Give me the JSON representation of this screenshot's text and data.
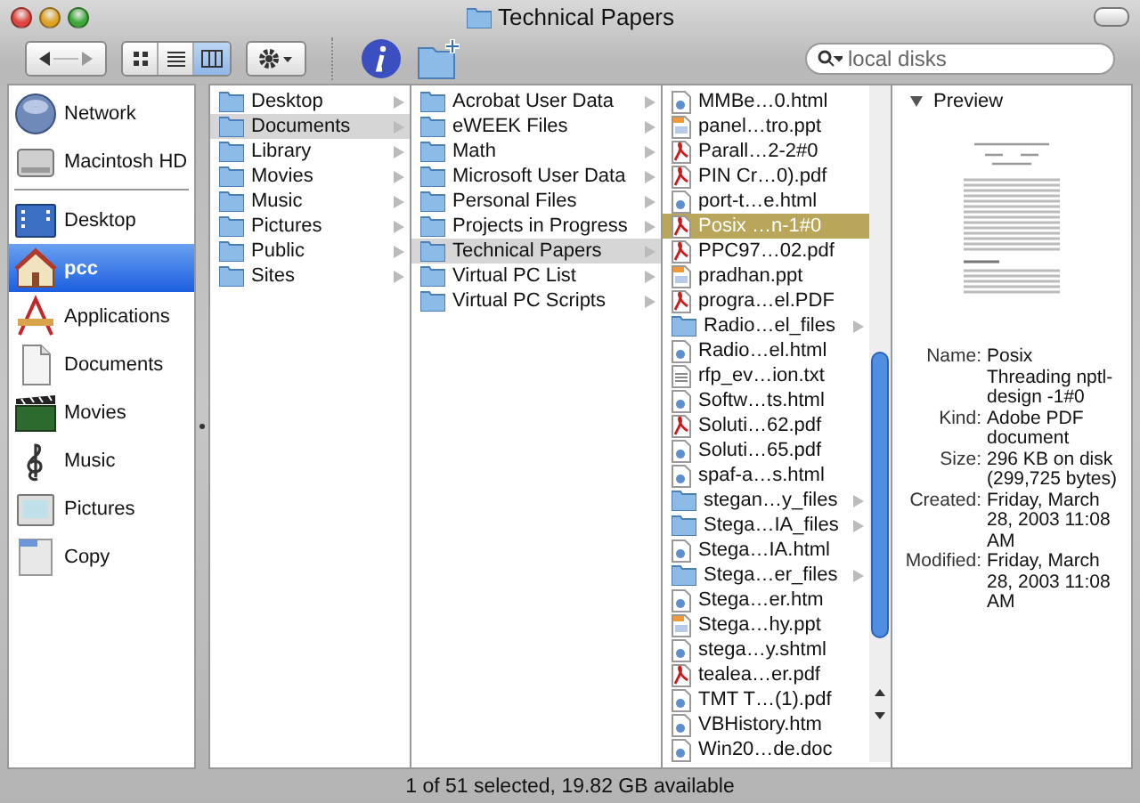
{
  "window": {
    "title": "Technical Papers"
  },
  "toolbar": {
    "views": [
      {
        "kind": "icon",
        "selected": false
      },
      {
        "kind": "list",
        "selected": false
      },
      {
        "kind": "column",
        "selected": true
      }
    ],
    "search": {
      "placeholder": "local disks"
    }
  },
  "sidebar": {
    "devices": [
      {
        "label": "Network",
        "kind": "network"
      },
      {
        "label": "Macintosh HD",
        "kind": "disk"
      }
    ],
    "places": [
      {
        "label": "Desktop",
        "kind": "desktop",
        "selected": false
      },
      {
        "label": "pcc",
        "kind": "home",
        "selected": true
      },
      {
        "label": "Applications",
        "kind": "applications",
        "selected": false
      },
      {
        "label": "Documents",
        "kind": "documents",
        "selected": false
      },
      {
        "label": "Movies",
        "kind": "movies",
        "selected": false
      },
      {
        "label": "Music",
        "kind": "music",
        "selected": false
      },
      {
        "label": "Pictures",
        "kind": "pictures",
        "selected": false
      },
      {
        "label": "Copy",
        "kind": "generic",
        "selected": false
      }
    ]
  },
  "columns": [
    {
      "active": false,
      "items": [
        {
          "name": "Desktop",
          "kind": "folder",
          "expandable": true,
          "selected": false
        },
        {
          "name": "Documents",
          "kind": "folder",
          "expandable": true,
          "selected": true
        },
        {
          "name": "Library",
          "kind": "folder",
          "expandable": true,
          "selected": false
        },
        {
          "name": "Movies",
          "kind": "folder",
          "expandable": true,
          "selected": false
        },
        {
          "name": "Music",
          "kind": "folder",
          "expandable": true,
          "selected": false
        },
        {
          "name": "Pictures",
          "kind": "folder",
          "expandable": true,
          "selected": false
        },
        {
          "name": "Public",
          "kind": "folder",
          "expandable": true,
          "selected": false
        },
        {
          "name": "Sites",
          "kind": "folder",
          "expandable": true,
          "selected": false
        }
      ]
    },
    {
      "active": false,
      "items": [
        {
          "name": "Acrobat User Data",
          "kind": "folder",
          "expandable": true,
          "selected": false
        },
        {
          "name": "eWEEK Files",
          "kind": "folder",
          "expandable": true,
          "selected": false
        },
        {
          "name": "Math",
          "kind": "folder",
          "expandable": true,
          "selected": false
        },
        {
          "name": "Microsoft User Data",
          "kind": "folder",
          "expandable": true,
          "selected": false
        },
        {
          "name": "Personal Files",
          "kind": "folder",
          "expandable": true,
          "selected": false
        },
        {
          "name": "Projects in Progress",
          "kind": "folder",
          "expandable": true,
          "selected": false
        },
        {
          "name": "Technical Papers",
          "kind": "folder",
          "expandable": true,
          "selected": true
        },
        {
          "name": "Virtual PC List",
          "kind": "folder",
          "expandable": true,
          "selected": false
        },
        {
          "name": "Virtual PC Scripts",
          "kind": "folder",
          "expandable": true,
          "selected": false
        }
      ]
    },
    {
      "active": true,
      "items": [
        {
          "name": "MMBe…0.html",
          "kind": "html",
          "expandable": false,
          "selected": false
        },
        {
          "name": "panel…tro.ppt",
          "kind": "ppt",
          "expandable": false,
          "selected": false
        },
        {
          "name": "Parall…2-2#0",
          "kind": "pdf",
          "expandable": false,
          "selected": false
        },
        {
          "name": "PIN Cr…0).pdf",
          "kind": "pdf",
          "expandable": false,
          "selected": false
        },
        {
          "name": "port-t…e.html",
          "kind": "html",
          "expandable": false,
          "selected": false
        },
        {
          "name": "Posix …n-1#0",
          "kind": "pdf",
          "expandable": false,
          "selected": true
        },
        {
          "name": "PPC97…02.pdf",
          "kind": "pdf",
          "expandable": false,
          "selected": false
        },
        {
          "name": "pradhan.ppt",
          "kind": "ppt",
          "expandable": false,
          "selected": false
        },
        {
          "name": "progra…el.PDF",
          "kind": "pdf",
          "expandable": false,
          "selected": false
        },
        {
          "name": "Radio…el_files",
          "kind": "folder",
          "expandable": true,
          "selected": false
        },
        {
          "name": "Radio…el.html",
          "kind": "html",
          "expandable": false,
          "selected": false
        },
        {
          "name": "rfp_ev…ion.txt",
          "kind": "txt",
          "expandable": false,
          "selected": false
        },
        {
          "name": "Softw…ts.html",
          "kind": "html",
          "expandable": false,
          "selected": false
        },
        {
          "name": "Soluti…62.pdf",
          "kind": "pdf",
          "expandable": false,
          "selected": false
        },
        {
          "name": "Soluti…65.pdf",
          "kind": "html",
          "expandable": false,
          "selected": false
        },
        {
          "name": "spaf-a…s.html",
          "kind": "html",
          "expandable": false,
          "selected": false
        },
        {
          "name": "stegan…y_files",
          "kind": "folder",
          "expandable": true,
          "selected": false
        },
        {
          "name": "Stega…IA_files",
          "kind": "folder",
          "expandable": true,
          "selected": false
        },
        {
          "name": "Stega…IA.html",
          "kind": "html",
          "expandable": false,
          "selected": false
        },
        {
          "name": "Stega…er_files",
          "kind": "folder",
          "expandable": true,
          "selected": false
        },
        {
          "name": "Stega…er.htm",
          "kind": "html",
          "expandable": false,
          "selected": false
        },
        {
          "name": "Stega…hy.ppt",
          "kind": "ppt",
          "expandable": false,
          "selected": false
        },
        {
          "name": "stega…y.shtml",
          "kind": "html",
          "expandable": false,
          "selected": false
        },
        {
          "name": "tealea…er.pdf",
          "kind": "pdf",
          "expandable": false,
          "selected": false
        },
        {
          "name": "TMT T…(1).pdf",
          "kind": "html",
          "expandable": false,
          "selected": false
        },
        {
          "name": "VBHistory.htm",
          "kind": "html",
          "expandable": false,
          "selected": false
        },
        {
          "name": "Win20…de.doc",
          "kind": "html",
          "expandable": false,
          "selected": false
        }
      ]
    }
  ],
  "preview": {
    "heading": "Preview",
    "info": [
      {
        "label": "Name:",
        "value": "Posix Threading nptl-design -1#0"
      },
      {
        "label": "Kind:",
        "value": "Adobe PDF document"
      },
      {
        "label": "Size:",
        "value": "296 KB on disk (299,725 bytes)"
      },
      {
        "label": "Created:",
        "value": "Friday, March 28, 2003 11:08 AM"
      },
      {
        "label": "Modified:",
        "value": "Friday, March 28, 2003 11:08 AM"
      }
    ]
  },
  "status_bar": "1 of 51 selected, 19.82 GB available"
}
